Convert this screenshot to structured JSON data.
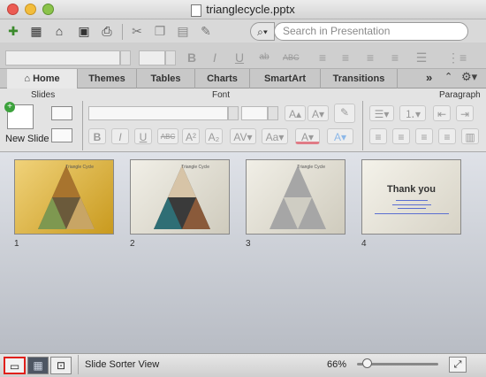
{
  "window": {
    "title": "trianglecycle.pptx"
  },
  "toolbar": {
    "search_placeholder": "Search in Presentation",
    "icons": [
      "new-icon",
      "gallery-icon",
      "open-icon",
      "save-icon",
      "print-icon",
      "cut-icon",
      "copy-icon",
      "paste-icon",
      "format-painter-icon",
      "search-icon"
    ]
  },
  "ribbon": {
    "tabs": [
      {
        "label": "Home",
        "active": true
      },
      {
        "label": "Themes"
      },
      {
        "label": "Tables"
      },
      {
        "label": "Charts"
      },
      {
        "label": "SmartArt"
      },
      {
        "label": "Transitions"
      }
    ],
    "groups": {
      "slides": "Slides",
      "font": "Font",
      "paragraph": "Paragraph"
    },
    "new_slide_label": "New Slide"
  },
  "slides": [
    {
      "number": "1",
      "title": "Triangle Cycle"
    },
    {
      "number": "2",
      "title": "Triangle Cycle"
    },
    {
      "number": "3",
      "title": "Triangle Cycle"
    },
    {
      "number": "4",
      "heading": "Thank you"
    }
  ],
  "status": {
    "view_name": "Slide Sorter View",
    "zoom": "66%",
    "zoom_level": 0.12
  },
  "colors": {
    "selected_view_outline": "#e0201b",
    "titlebar": "#d9d9d9"
  }
}
